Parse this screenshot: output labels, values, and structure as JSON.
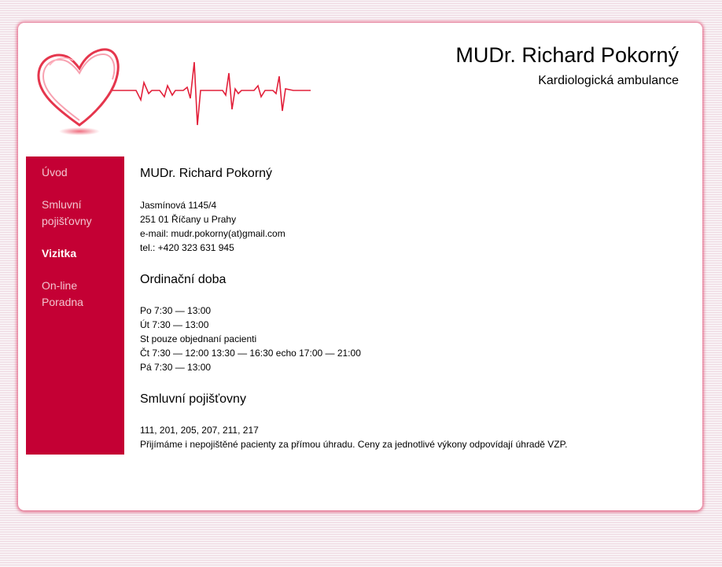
{
  "header": {
    "title": "MUDr. Richard Pokorný",
    "subtitle": "Kardiologická ambulance",
    "logo_icon": "heart-ecg-logo-icon"
  },
  "colors": {
    "accent": "#c40034",
    "logo_red": "#e2203a",
    "nav_text": "#f2c4d0",
    "nav_active": "#ffffff"
  },
  "sidebar": {
    "items": [
      {
        "label": "Úvod",
        "active": false
      },
      {
        "label": "Smluvní pojišťovny",
        "active": false
      },
      {
        "label": "Vizitka",
        "active": true
      },
      {
        "label": "On-line Poradna",
        "active": false
      }
    ]
  },
  "main": {
    "contact_heading": "MUDr. Richard Pokorný",
    "contact_lines": [
      "Jasmínová 1145/4",
      "251 01 Říčany u Prahy",
      "e-mail: mudr.pokorny(at)gmail.com",
      "tel.: +420 323 631 945"
    ],
    "hours_heading": "Ordinační doba",
    "hours_lines": [
      "Po 7:30 — 13:00",
      "Út 7:30 — 13:00",
      "St pouze objednaní pacienti",
      "Čt 7:30 — 12:00 13:30 — 16:30 echo 17:00 — 21:00",
      "Pá 7:30 — 13:00"
    ],
    "insurance_heading": "Smluvní pojišťovny",
    "insurance_lines": [
      "111, 201, 205, 207, 211, 217",
      "Přijímáme i nepojištěné pacienty za přímou úhradu. Ceny za jednotlivé výkony odpovídají úhradě VZP."
    ]
  }
}
